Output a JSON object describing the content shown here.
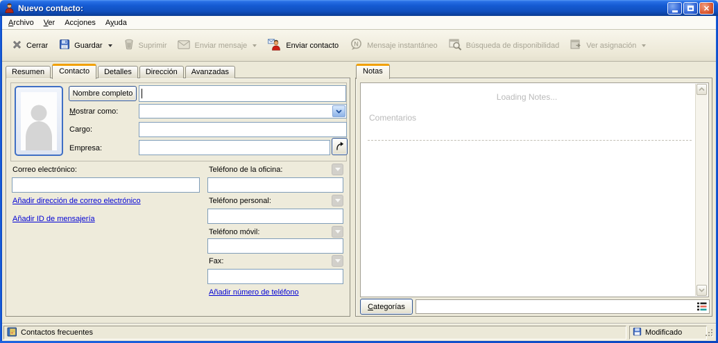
{
  "window": {
    "title": "Nuevo contacto:"
  },
  "menu": {
    "items": [
      {
        "pre": "",
        "key": "A",
        "post": "rchivo"
      },
      {
        "pre": "",
        "key": "V",
        "post": "er"
      },
      {
        "pre": "Acc",
        "key": "i",
        "post": "ones"
      },
      {
        "pre": "A",
        "key": "y",
        "post": "uda"
      }
    ]
  },
  "toolbar": {
    "buttons": [
      {
        "label": "Cerrar",
        "icon": "close-x-icon",
        "enabled": true,
        "has_dropdown": false
      },
      {
        "label": "Guardar",
        "icon": "save-floppy-icon",
        "enabled": true,
        "has_dropdown": true
      },
      {
        "label": "Suprimir",
        "icon": "trash-icon",
        "enabled": false,
        "has_dropdown": false
      },
      {
        "label": "Enviar mensaje",
        "icon": "envelope-icon",
        "enabled": false,
        "has_dropdown": true
      },
      {
        "label": "Enviar contacto",
        "icon": "send-contact-icon",
        "enabled": true,
        "has_dropdown": false
      },
      {
        "label": "Mensaje instantáneo",
        "icon": "instant-message-icon",
        "enabled": false,
        "has_dropdown": false
      },
      {
        "label": "Búsqueda de disponibilidad",
        "icon": "availability-search-icon",
        "enabled": false,
        "has_dropdown": false
      },
      {
        "label": "Ver asignación",
        "icon": "appointment-icon",
        "enabled": false,
        "has_dropdown": true
      }
    ]
  },
  "tabs": {
    "left": [
      "Resumen",
      "Contacto",
      "Detalles",
      "Dirección",
      "Avanzadas"
    ],
    "active_left": "Contacto",
    "right": [
      "Notas"
    ],
    "active_right": "Notas"
  },
  "contact_form": {
    "full_name": {
      "button_label": "Nombre completo",
      "value": ""
    },
    "display_as": {
      "label_key": "M",
      "label_rest": "ostrar como:",
      "value": ""
    },
    "job_title": {
      "label": "Cargo:",
      "value": ""
    },
    "company": {
      "label": "Empresa:",
      "value": ""
    },
    "email": {
      "label": "Correo electrónico:",
      "value": ""
    },
    "add_email_link": "Añadir dirección de correo electrónico",
    "add_im_link": "Añadir ID de mensajería",
    "phones": [
      {
        "label": "Teléfono de la oficina:",
        "value": ""
      },
      {
        "label": "Teléfono personal:",
        "value": ""
      },
      {
        "label": "Teléfono móvil:",
        "value": ""
      },
      {
        "label": "Fax:",
        "value": ""
      }
    ],
    "add_phone_link": "Añadir número de teléfono"
  },
  "notes": {
    "loading_text": "Loading Notes...",
    "comments_label": "Comentarios"
  },
  "categories": {
    "button_key": "C",
    "button_rest": "ategorías",
    "value": ""
  },
  "status_bar": {
    "left": "Contactos frecuentes",
    "right": "Modificado"
  },
  "colors": {
    "titlebar_blue": "#1155c9",
    "window_border": "#0a45be",
    "active_tab_orange": "#f1a000",
    "link_blue": "#0000d4",
    "background": "#ece9d8",
    "input_border": "#7f9db9",
    "disabled_text": "#a8a595",
    "placeholder_gray": "#b9b9b9"
  }
}
